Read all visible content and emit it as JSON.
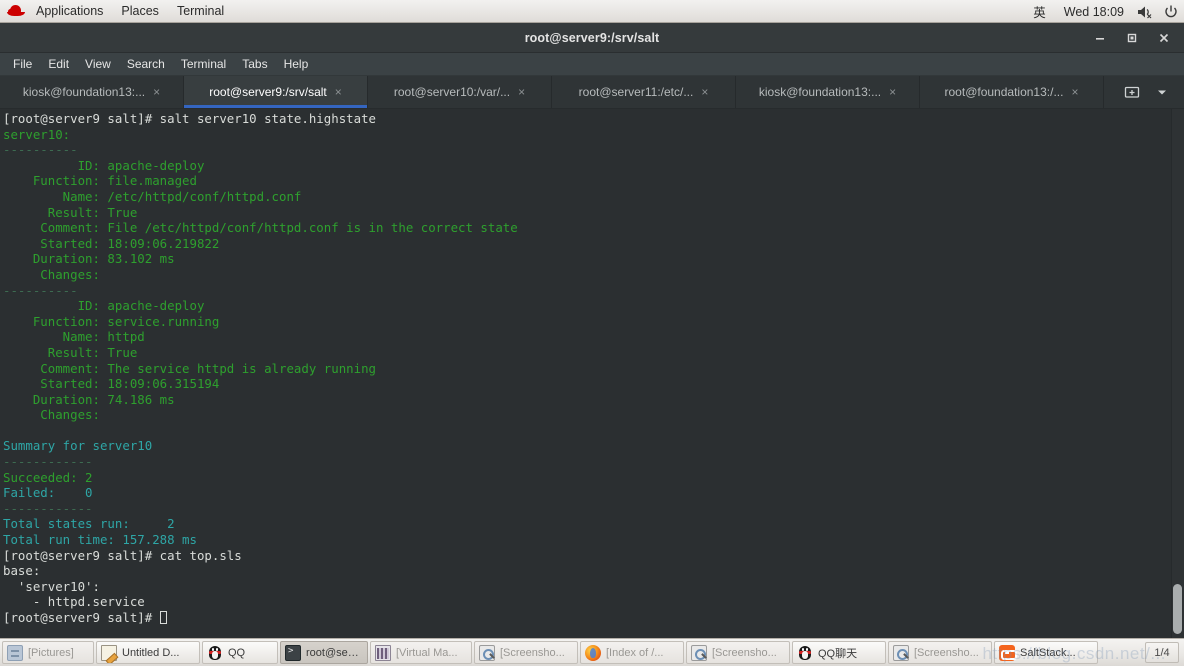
{
  "top_panel": {
    "logo_icon": "redhat-logo-icon",
    "menus": [
      "Applications",
      "Places",
      "Terminal"
    ],
    "ime": "英",
    "clock": "Wed 18:09",
    "volume_icon": "volume-muted-icon",
    "power_icon": "power-icon"
  },
  "window": {
    "title": "root@server9:/srv/salt",
    "minimize_icon": "minimize-icon",
    "maximize_icon": "maximize-icon",
    "close_icon": "close-icon",
    "menus": [
      "File",
      "Edit",
      "View",
      "Search",
      "Terminal",
      "Tabs",
      "Help"
    ]
  },
  "tabs": {
    "items": [
      {
        "label": "kiosk@foundation13:...",
        "active": false
      },
      {
        "label": "root@server9:/srv/salt",
        "active": true
      },
      {
        "label": "root@server10:/var/...",
        "active": false
      },
      {
        "label": "root@server11:/etc/...",
        "active": false
      },
      {
        "label": "kiosk@foundation13:...",
        "active": false
      },
      {
        "label": "root@foundation13:/...",
        "active": false
      }
    ],
    "close_icon": "close-icon",
    "new_tab_icon": "new-tab-icon",
    "tab_list_icon": "chevron-down-icon"
  },
  "terminal": {
    "prompt": "[root@server9 salt]#",
    "lines": [
      {
        "text": "[root@server9 salt]# salt server10 state.highstate",
        "color": "white"
      },
      {
        "text": "server10:",
        "color": "green"
      },
      {
        "text": "----------",
        "color": "gray"
      },
      {
        "text": "          ID: apache-deploy",
        "color": "green"
      },
      {
        "text": "    Function: file.managed",
        "color": "green"
      },
      {
        "text": "        Name: /etc/httpd/conf/httpd.conf",
        "color": "green"
      },
      {
        "text": "      Result: True",
        "color": "green"
      },
      {
        "text": "     Comment: File /etc/httpd/conf/httpd.conf is in the correct state",
        "color": "green"
      },
      {
        "text": "     Started: 18:09:06.219822",
        "color": "green"
      },
      {
        "text": "    Duration: 83.102 ms",
        "color": "green"
      },
      {
        "text": "     Changes:   ",
        "color": "green"
      },
      {
        "text": "----------",
        "color": "gray"
      },
      {
        "text": "          ID: apache-deploy",
        "color": "green"
      },
      {
        "text": "    Function: service.running",
        "color": "green"
      },
      {
        "text": "        Name: httpd",
        "color": "green"
      },
      {
        "text": "      Result: True",
        "color": "green"
      },
      {
        "text": "     Comment: The service httpd is already running",
        "color": "green"
      },
      {
        "text": "     Started: 18:09:06.315194",
        "color": "green"
      },
      {
        "text": "    Duration: 74.186 ms",
        "color": "green"
      },
      {
        "text": "     Changes:   ",
        "color": "green"
      },
      {
        "text": "",
        "color": "green"
      },
      {
        "text": "Summary for server10",
        "color": "cyan"
      },
      {
        "text": "------------",
        "color": "gray"
      },
      {
        "text": "Succeeded: 2",
        "color": "green"
      },
      {
        "text": "Failed:    0",
        "color": "cyan"
      },
      {
        "text": "------------",
        "color": "gray"
      },
      {
        "text": "Total states run:     2",
        "color": "cyan"
      },
      {
        "text": "Total run time: 157.288 ms",
        "color": "cyan"
      },
      {
        "text": "[root@server9 salt]# cat top.sls",
        "color": "white"
      },
      {
        "text": "base:",
        "color": "white"
      },
      {
        "text": "  'server10':",
        "color": "white"
      },
      {
        "text": "    - httpd.service",
        "color": "white"
      },
      {
        "text": "[root@server9 salt]# ",
        "color": "white",
        "cursor": true
      }
    ],
    "scrollbar": "vertical-scrollbar"
  },
  "taskbar": {
    "items": [
      {
        "label": "[Pictures]",
        "icon": "drawer-icon",
        "state": "dim"
      },
      {
        "label": "Untitled D...",
        "icon": "note-icon",
        "state": "normal"
      },
      {
        "label": "QQ",
        "icon": "penguin-icon",
        "state": "normal"
      },
      {
        "label": "root@serv...",
        "icon": "terminal-icon",
        "state": "active"
      },
      {
        "label": "[Virtual Ma...",
        "icon": "vm-icon",
        "state": "dim"
      },
      {
        "label": "[Screensho...",
        "icon": "screenshot-icon",
        "state": "dim"
      },
      {
        "label": "[Index of /...",
        "icon": "firefox-icon",
        "state": "dim"
      },
      {
        "label": "[Screensho...",
        "icon": "screenshot-icon",
        "state": "dim"
      },
      {
        "label": "QQ聊天",
        "icon": "penguin-icon",
        "state": "normal"
      },
      {
        "label": "[Screensho...",
        "icon": "screenshot-icon",
        "state": "dim"
      },
      {
        "label": "SaltStack...",
        "icon": "salt-icon",
        "state": "normal"
      }
    ],
    "workspace_counter": "1/4",
    "watermark": "https://blog.csdn.net/..."
  }
}
